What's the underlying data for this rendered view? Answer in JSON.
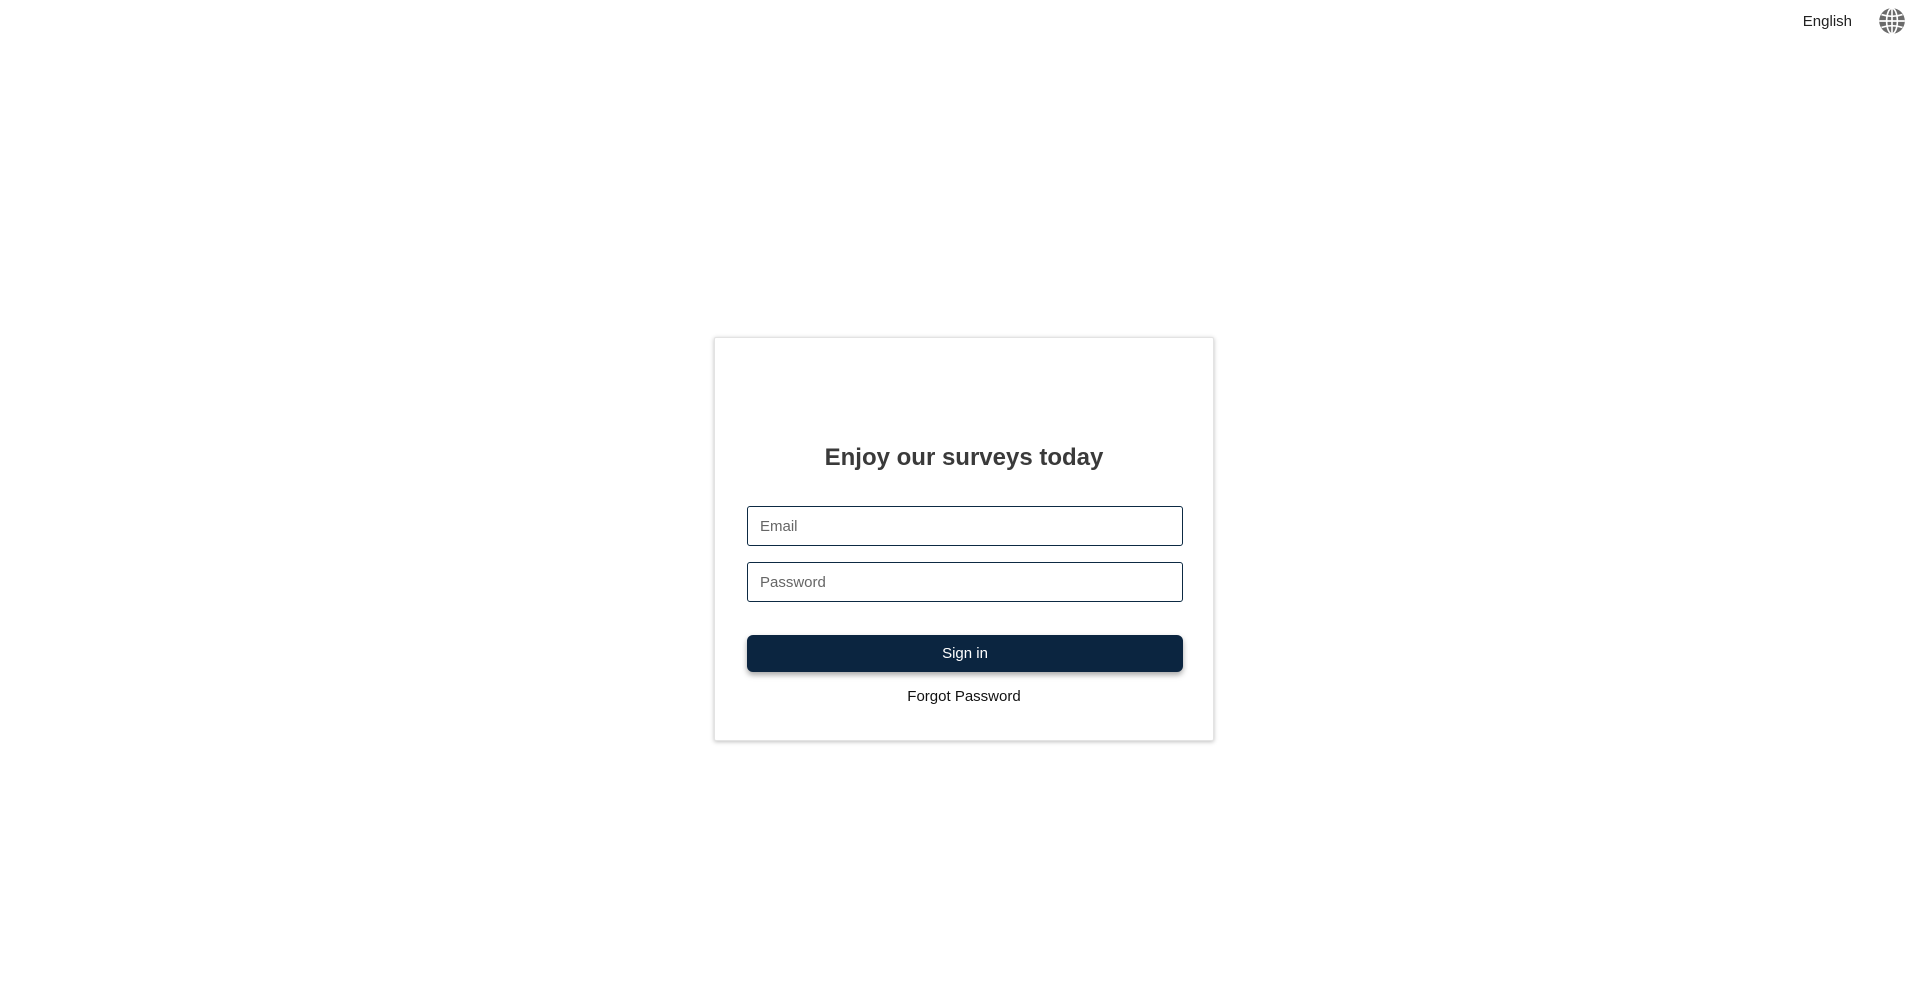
{
  "header": {
    "language_label": "English",
    "language_icon": "globe-icon"
  },
  "login": {
    "title": "Enjoy our surveys today",
    "email": {
      "value": "",
      "placeholder": "Email"
    },
    "password": {
      "value": "",
      "placeholder": "Password"
    },
    "sign_in_label": "Sign in",
    "forgot_password_label": "Forgot Password"
  },
  "colors": {
    "primary": "#0b2540",
    "field_border": "#0d2a43",
    "title": "#3a3a3a",
    "icon": "#6b6b6b"
  }
}
